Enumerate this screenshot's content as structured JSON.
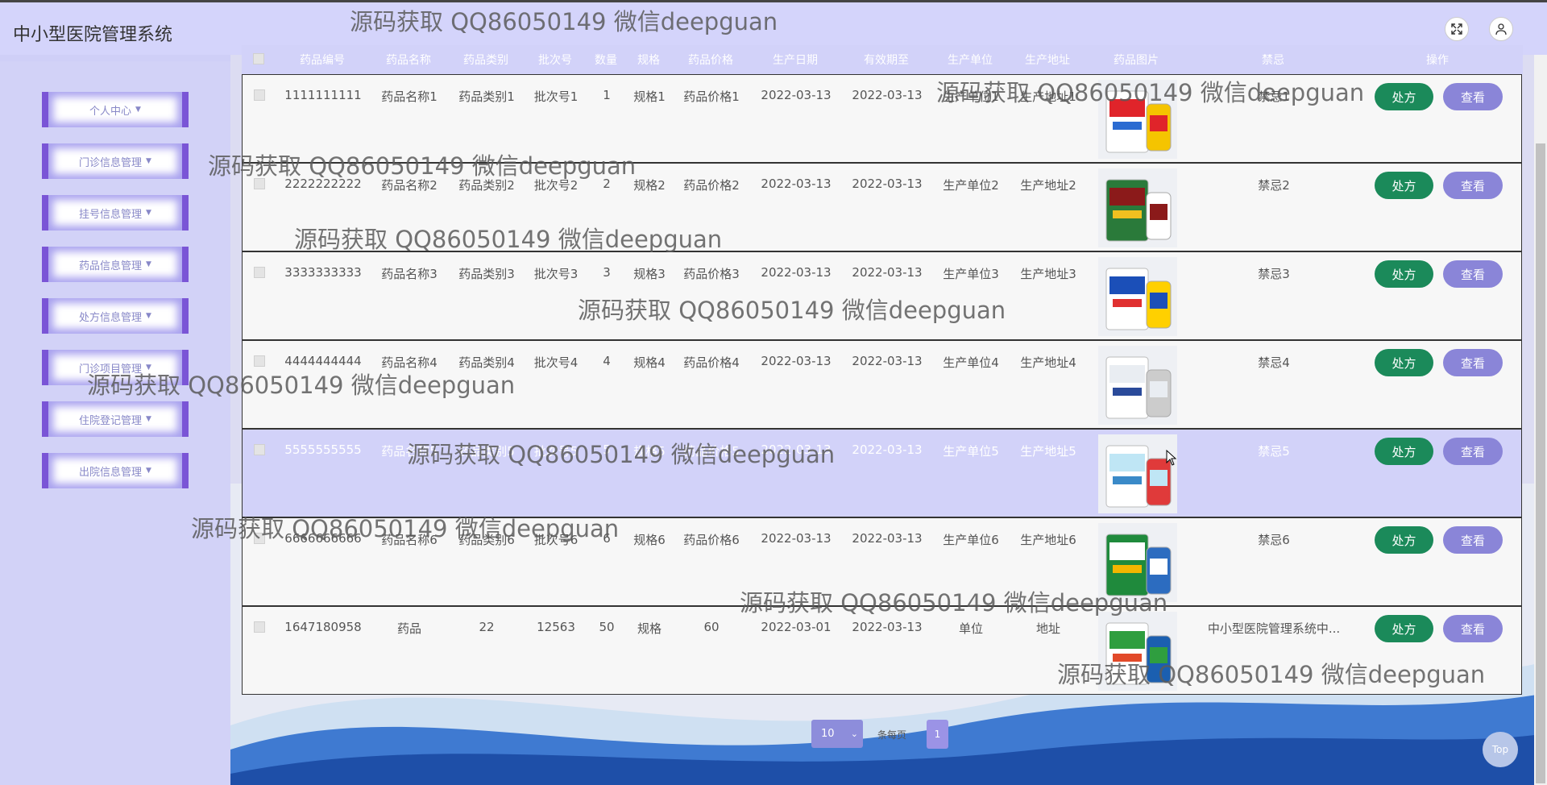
{
  "app": {
    "title": "中小型医院管理系统"
  },
  "header_icons": [
    "fullscreen-icon",
    "user-icon"
  ],
  "sidebar": {
    "items": [
      {
        "label": "个人中心"
      },
      {
        "label": "门诊信息管理"
      },
      {
        "label": "挂号信息管理"
      },
      {
        "label": "药品信息管理"
      },
      {
        "label": "处方信息管理"
      },
      {
        "label": "门诊项目管理"
      },
      {
        "label": "住院登记管理"
      },
      {
        "label": "出院信息管理"
      }
    ]
  },
  "table": {
    "headers": [
      "药品编号",
      "药品名称",
      "药品类别",
      "批次号",
      "数量",
      "规格",
      "药品价格",
      "生产日期",
      "有效期至",
      "生产单位",
      "生产地址",
      "药品图片",
      "禁忌",
      "操作"
    ],
    "rows": [
      {
        "id": "1111111111",
        "name": "药品名称1",
        "category": "药品类别1",
        "batch": "批次号1",
        "qty": "1",
        "spec": "规格1",
        "price": "药品价格1",
        "made": "2022-03-13",
        "expire": "2022-03-13",
        "maker": "生产单位1",
        "address": "生产地址1",
        "taboo": "禁忌1",
        "highlight": false
      },
      {
        "id": "2222222222",
        "name": "药品名称2",
        "category": "药品类别2",
        "batch": "批次号2",
        "qty": "2",
        "spec": "规格2",
        "price": "药品价格2",
        "made": "2022-03-13",
        "expire": "2022-03-13",
        "maker": "生产单位2",
        "address": "生产地址2",
        "taboo": "禁忌2",
        "highlight": false
      },
      {
        "id": "3333333333",
        "name": "药品名称3",
        "category": "药品类别3",
        "batch": "批次号3",
        "qty": "3",
        "spec": "规格3",
        "price": "药品价格3",
        "made": "2022-03-13",
        "expire": "2022-03-13",
        "maker": "生产单位3",
        "address": "生产地址3",
        "taboo": "禁忌3",
        "highlight": false
      },
      {
        "id": "4444444444",
        "name": "药品名称4",
        "category": "药品类别4",
        "batch": "批次号4",
        "qty": "4",
        "spec": "规格4",
        "price": "药品价格4",
        "made": "2022-03-13",
        "expire": "2022-03-13",
        "maker": "生产单位4",
        "address": "生产地址4",
        "taboo": "禁忌4",
        "highlight": false
      },
      {
        "id": "5555555555",
        "name": "药品名称5",
        "category": "药品类别5",
        "batch": "批次号5",
        "qty": "5",
        "spec": "规格5",
        "price": "药品价格5",
        "made": "2022-03-13",
        "expire": "2022-03-13",
        "maker": "生产单位5",
        "address": "生产地址5",
        "taboo": "禁忌5",
        "highlight": true
      },
      {
        "id": "6666666666",
        "name": "药品名称6",
        "category": "药品类别6",
        "batch": "批次号6",
        "qty": "6",
        "spec": "规格6",
        "price": "药品价格6",
        "made": "2022-03-13",
        "expire": "2022-03-13",
        "maker": "生产单位6",
        "address": "生产地址6",
        "taboo": "禁忌6",
        "highlight": false
      },
      {
        "id": "1647180958",
        "name": "药品",
        "category": "22",
        "batch": "12563",
        "qty": "50",
        "spec": "规格",
        "price": "60",
        "made": "2022-03-01",
        "expire": "2022-03-13",
        "maker": "单位",
        "address": "地址",
        "taboo": "中小型医院管理系统中...",
        "highlight": false
      }
    ],
    "actions": {
      "prescribe": "处方",
      "view": "查看"
    }
  },
  "pagination": {
    "page_size": "10",
    "per_page_label": "条每页",
    "current_page": "1"
  },
  "top_button": "Top",
  "watermark_text": "源码获取 QQ86050149 微信deepguan",
  "colors": {
    "accent": "#d2d2f9",
    "sidebar_border": "#7a55d6",
    "prescribe": "#1b8a5a",
    "view": "#8a85d8"
  }
}
